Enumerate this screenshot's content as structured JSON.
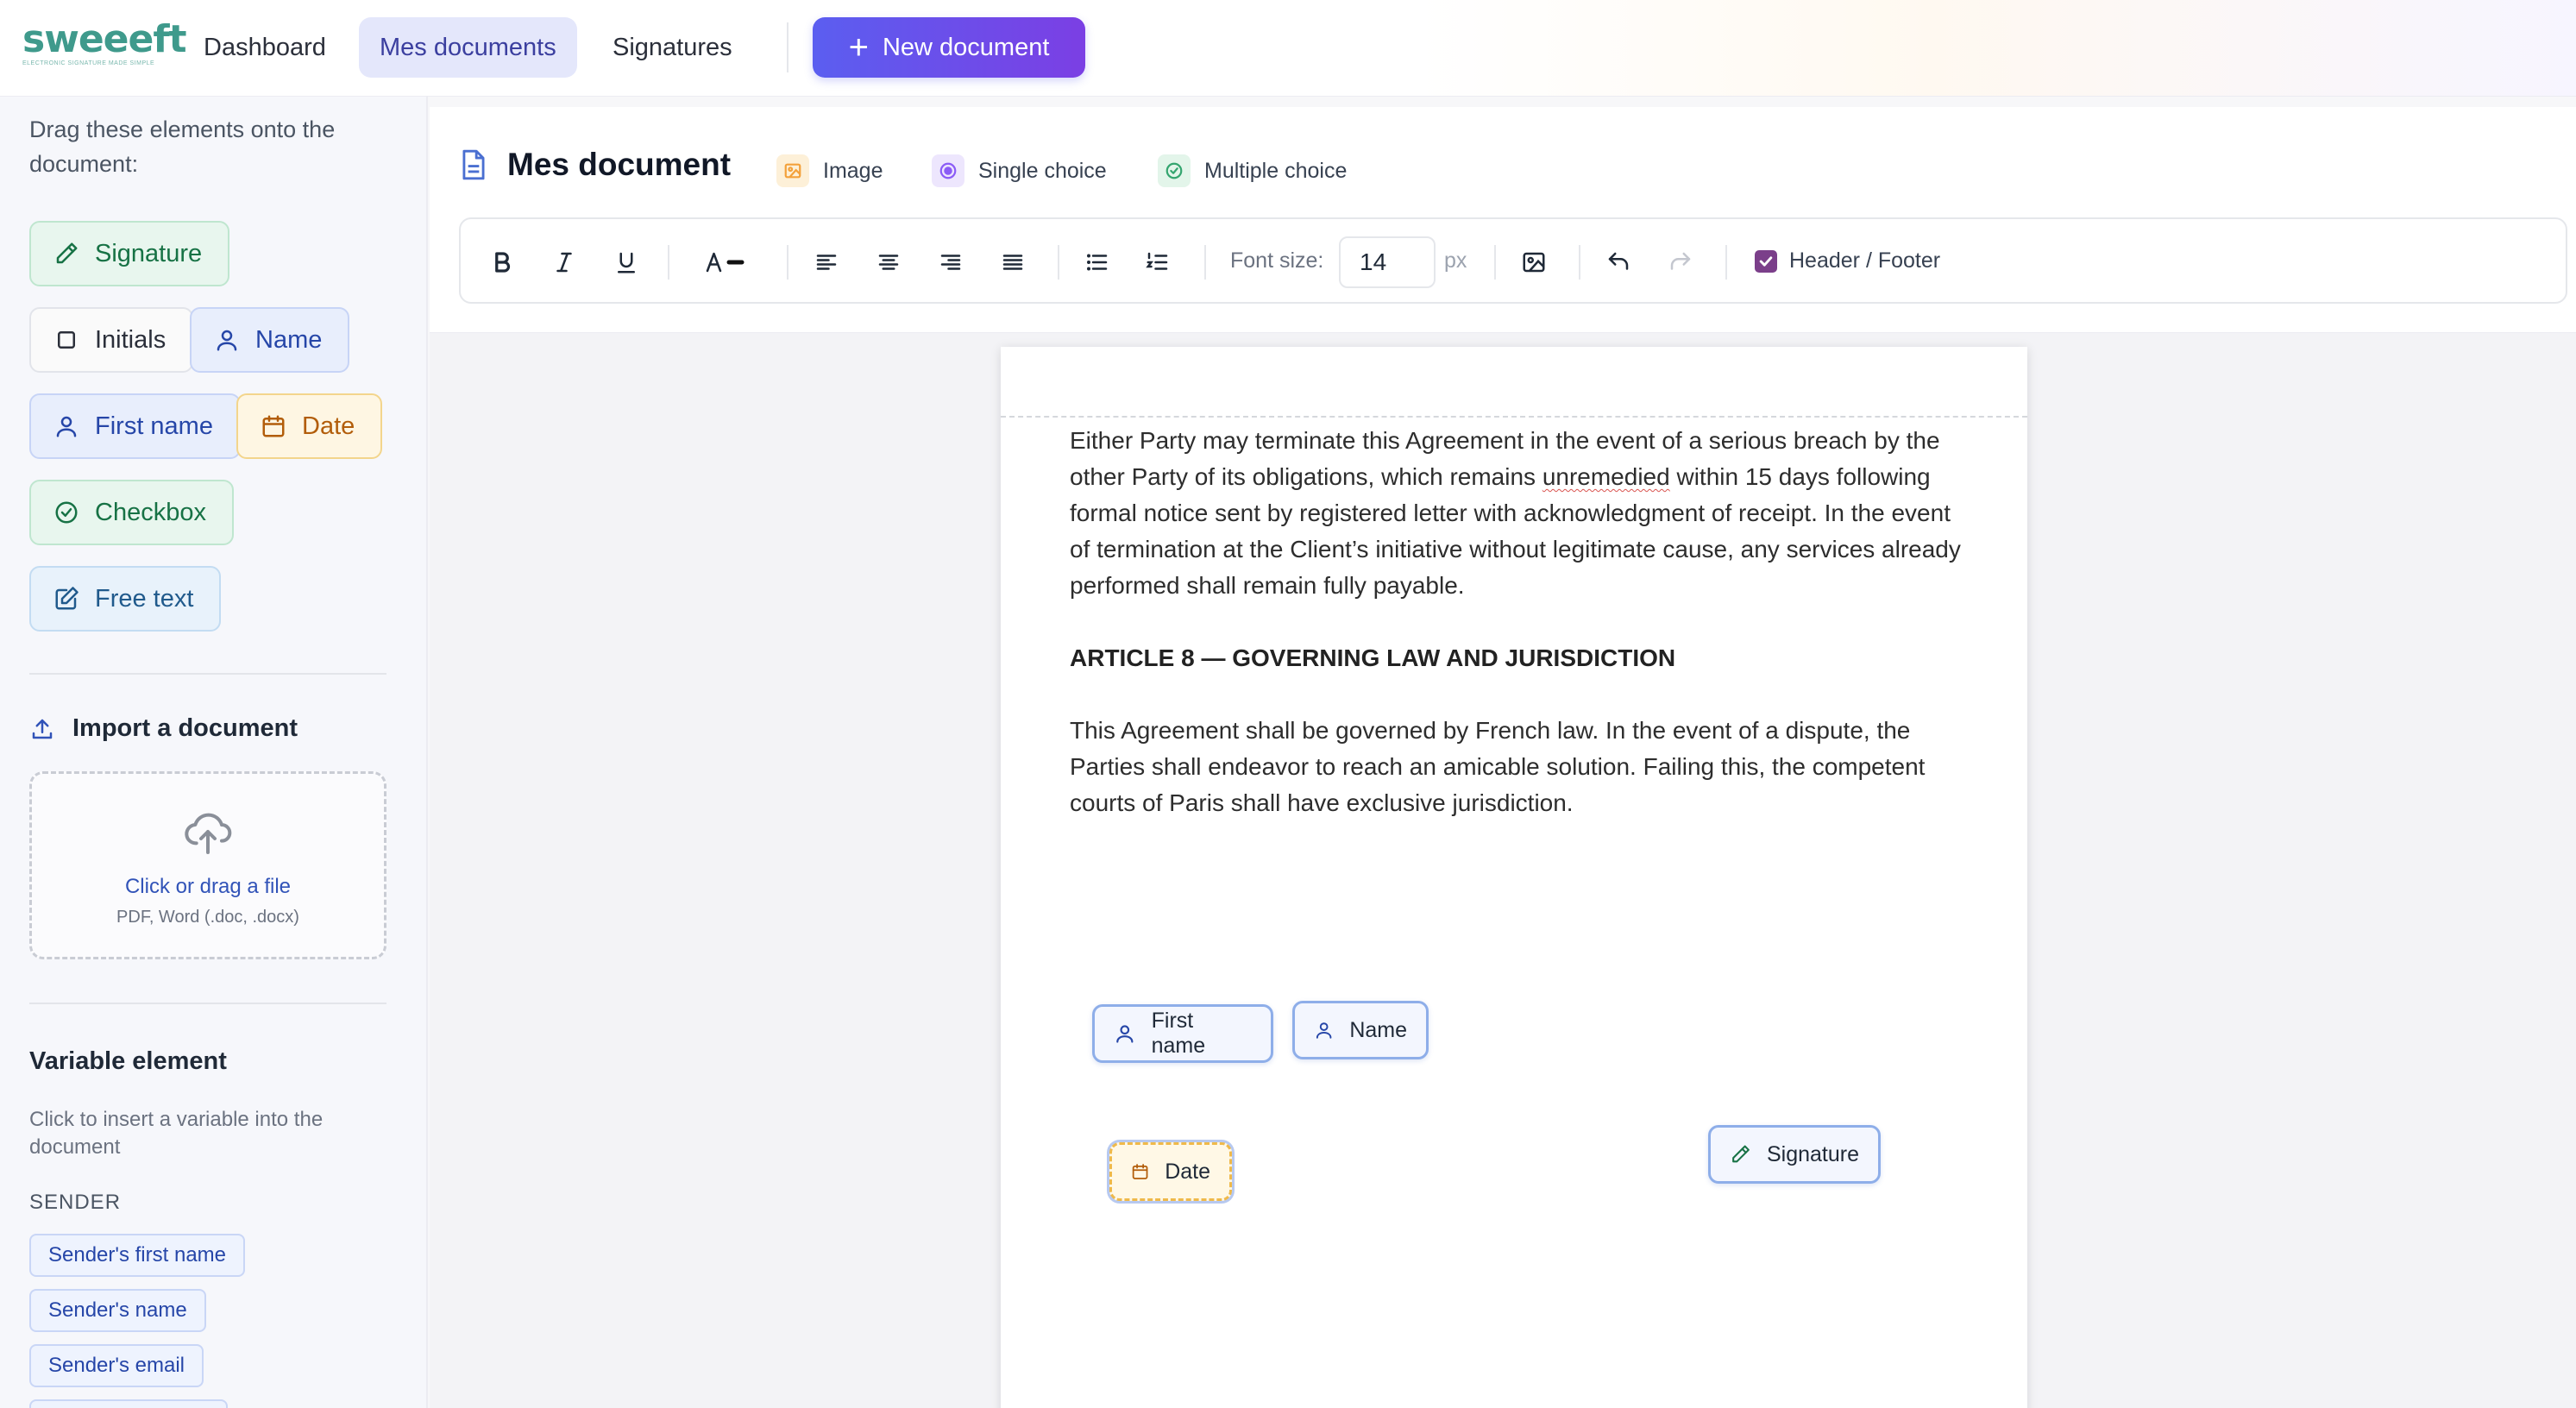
{
  "logo": {
    "word": "sweeeft",
    "tagline": "ELECTRONIC SIGNATURE MADE SIMPLE"
  },
  "nav": {
    "items": [
      {
        "label": "Dashboard"
      },
      {
        "label": "Mes documents"
      },
      {
        "label": "Signatures"
      }
    ],
    "new_document": "New document"
  },
  "sidebar": {
    "intro": "Drag these elements onto the document:",
    "elements": [
      {
        "label": "Signature",
        "icon": "pencil-icon"
      },
      {
        "label": "Initials",
        "icon": "square-icon"
      },
      {
        "label": "Name",
        "icon": "user-icon"
      },
      {
        "label": "First name",
        "icon": "user-icon"
      },
      {
        "label": "Date",
        "icon": "calendar-icon"
      },
      {
        "label": "Checkbox",
        "icon": "check-circle-icon"
      },
      {
        "label": "Free text",
        "icon": "edit-icon"
      }
    ],
    "import": {
      "title": "Import a document",
      "dropzone_main": "Click or drag a file",
      "dropzone_sub": "PDF, Word (.doc, .docx)"
    },
    "variables": {
      "title": "Variable element",
      "description": "Click to insert a variable into the document",
      "section": "SENDER",
      "items": [
        "Sender's first name",
        "Sender's name",
        "Sender's email"
      ]
    }
  },
  "document": {
    "title": "Mes document",
    "insert_tools": [
      {
        "label": "Image",
        "color": "#f3a13b"
      },
      {
        "label": "Single choice",
        "color": "#8b5cf6"
      },
      {
        "label": "Multiple choice",
        "color": "#34a56f"
      }
    ],
    "toolbar": {
      "font_size_label": "Font size:",
      "font_size_value": "14",
      "font_size_unit": "px",
      "header_footer_label": "Header / Footer",
      "header_footer_checked": true
    },
    "body": {
      "para1_a": "Either Party may terminate this Agreement in the event of a serious breach by the other Party of its obligations, which remains ",
      "para1_misspelled": "unremedied",
      "para1_b": " within 15 days following formal notice sent by registered letter with acknowledgment of receipt. In the event of termination at the Client’s initiative without legitimate cause, any services already performed shall remain fully payable.",
      "article_heading": "ARTICLE 8 — GOVERNING LAW AND JURISDICTION",
      "para2": "This Agreement shall be governed by French law. In the event of a dispute, the Parties shall endeavor to reach an amicable solution. Failing this, the competent courts of Paris shall have exclusive jurisdiction."
    },
    "placed_fields": [
      {
        "label": "First name",
        "icon": "user-icon"
      },
      {
        "label": "Name",
        "icon": "user-icon"
      },
      {
        "label": "Date",
        "icon": "calendar-icon"
      },
      {
        "label": "Signature",
        "icon": "pencil-icon"
      }
    ]
  },
  "colors": {
    "brand": "#3f9a8c",
    "primary_gradient_start": "#5b5ef0",
    "primary_gradient_end": "#7b3fe4",
    "nav_active_bg": "#e4e7fb"
  }
}
